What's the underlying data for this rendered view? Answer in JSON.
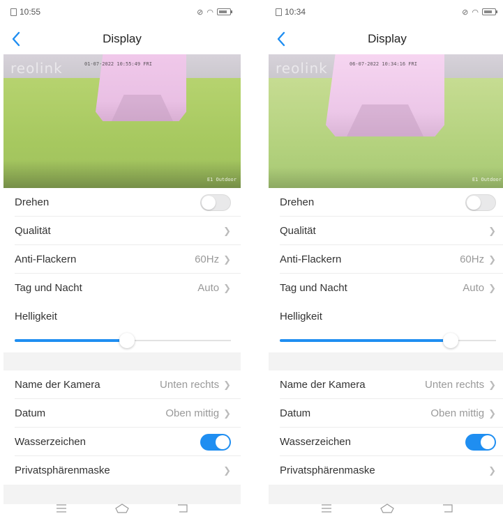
{
  "screens": [
    {
      "time": "10:55",
      "title": "Display",
      "preview": {
        "watermark": "reolink",
        "timestamp": "01-07-2022 10:55:49 FRI",
        "camera_name": "E1 Outdoor"
      },
      "rows_top": [
        {
          "label": "Drehen",
          "type": "toggle",
          "state": "off"
        },
        {
          "label": "Qualität",
          "type": "link",
          "value": ""
        },
        {
          "label": "Anti-Flackern",
          "type": "link",
          "value": "60Hz"
        },
        {
          "label": "Tag und Nacht",
          "type": "link",
          "value": "Auto"
        }
      ],
      "brightness": {
        "label": "Helligkeit",
        "value_fraction": 0.52
      },
      "rows_bottom": [
        {
          "label": "Name der Kamera",
          "type": "link",
          "value": "Unten rechts"
        },
        {
          "label": "Datum",
          "type": "link",
          "value": "Oben mittig"
        },
        {
          "label": "Wasserzeichen",
          "type": "toggle",
          "state": "on"
        },
        {
          "label": "Privatsphärenmaske",
          "type": "link",
          "value": ""
        }
      ]
    },
    {
      "time": "10:34",
      "title": "Display",
      "preview": {
        "watermark": "reolink",
        "timestamp": "06-07-2022 10:34:16 FRI",
        "camera_name": "E1 Outdoor"
      },
      "rows_top": [
        {
          "label": "Drehen",
          "type": "toggle",
          "state": "off"
        },
        {
          "label": "Qualität",
          "type": "link",
          "value": ""
        },
        {
          "label": "Anti-Flackern",
          "type": "link",
          "value": "60Hz"
        },
        {
          "label": "Tag und Nacht",
          "type": "link",
          "value": "Auto"
        }
      ],
      "brightness": {
        "label": "Helligkeit",
        "value_fraction": 0.79
      },
      "rows_bottom": [
        {
          "label": "Name der Kamera",
          "type": "link",
          "value": "Unten rechts"
        },
        {
          "label": "Datum",
          "type": "link",
          "value": "Oben mittig"
        },
        {
          "label": "Wasserzeichen",
          "type": "toggle",
          "state": "on"
        },
        {
          "label": "Privatsphärenmaske",
          "type": "link",
          "value": ""
        }
      ]
    }
  ],
  "colors": {
    "accent": "#1f8ef1",
    "divider": "#ececec",
    "section_gap": "#f3f3f3"
  },
  "icons": {
    "back": "chevron-left-icon",
    "menu": "menu-icon",
    "home": "home-icon",
    "return": "back-icon"
  }
}
